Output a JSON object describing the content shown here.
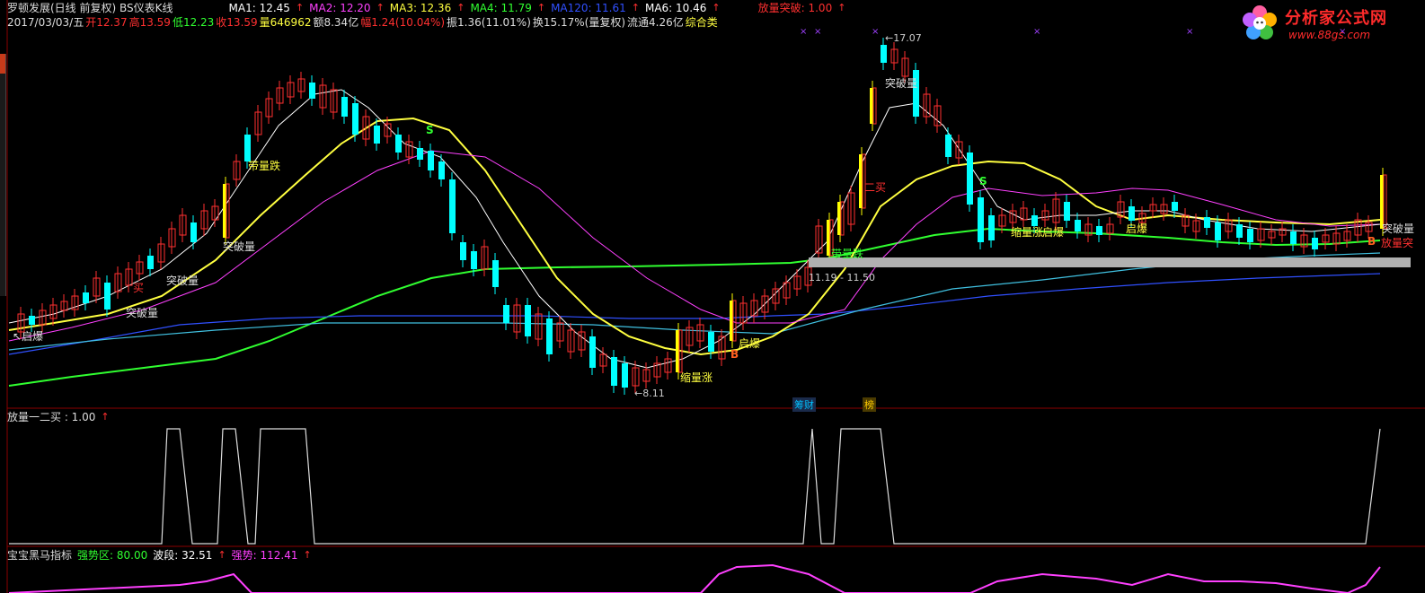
{
  "header": {
    "title": "罗顿发展(日线 前复权) BS仪表K线",
    "ma": [
      {
        "label": "MA1: 12.45",
        "color": "#ffffff"
      },
      {
        "label": "MA2: 12.20",
        "color": "#ff40ff"
      },
      {
        "label": "MA3: 12.36",
        "color": "#ffff40"
      },
      {
        "label": "MA4: 11.79",
        "color": "#30ff30"
      },
      {
        "label": "MA120: 11.61",
        "color": "#3050ff"
      },
      {
        "label": "MA6: 10.46",
        "color": "#ffffff"
      }
    ],
    "signal_label": "放量突破: 1.00",
    "signal_color": "#ff3030"
  },
  "quote": {
    "date": "2017/03/03/五",
    "open": "开12.37",
    "high": "高13.59",
    "low": "低12.23",
    "close": "收13.59",
    "volume": "量646962",
    "amount": "额8.34亿",
    "change": "幅1.24(10.04%)",
    "swing": "振1.36(11.01%)",
    "turnover": "换15.17%(量复权)",
    "float_cap": "流通4.26亿",
    "category": "综合类"
  },
  "logo": {
    "title": "分析家公式网",
    "url": "www.88gs.com"
  },
  "annotations": {
    "high_price": "17.07",
    "low_price": "8.11",
    "range": "11.19 - 11.50",
    "tag_cai": "筹财",
    "tag_bang": "榜"
  },
  "chart_labels": {
    "qibao": "启爆",
    "tupoliang": "突破量",
    "daiwangdie": "带量跌",
    "suoliangzhang": "缩量涨",
    "mai": "买",
    "mai2": "二买",
    "s": "S",
    "b": "B",
    "fangliangtu": "放量突"
  },
  "panel2": {
    "label": "放量一二买 : 1.00"
  },
  "panel3": {
    "name": "宝宝黑马指标",
    "zone": "强势区: 80.00",
    "band": "波段: 32.51",
    "strong": "强势: 112.41"
  },
  "colors": {
    "up": "#ff3030",
    "down": "#00ffff",
    "ma_white": "#ffffff",
    "ma_yellow": "#ffff40",
    "ma_magenta": "#ff40ff",
    "ma_green": "#30ff30",
    "ma_blue": "#3050ff",
    "ma_cyan": "#40c0e0",
    "signal_bar": "#ffff00"
  }
}
